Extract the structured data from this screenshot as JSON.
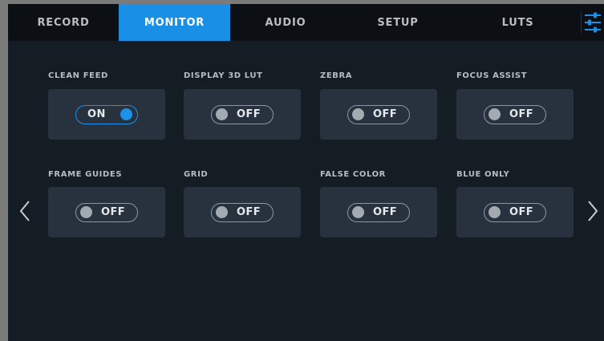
{
  "tabs": [
    {
      "label": "RECORD",
      "active": false
    },
    {
      "label": "MONITOR",
      "active": true
    },
    {
      "label": "AUDIO",
      "active": false
    },
    {
      "label": "SETUP",
      "active": false
    },
    {
      "label": "LUTS",
      "active": false
    }
  ],
  "settings": [
    {
      "label": "CLEAN FEED",
      "state": "ON"
    },
    {
      "label": "DISPLAY 3D LUT",
      "state": "OFF"
    },
    {
      "label": "ZEBRA",
      "state": "OFF"
    },
    {
      "label": "FOCUS ASSIST",
      "state": "OFF"
    },
    {
      "label": "FRAME GUIDES",
      "state": "OFF"
    },
    {
      "label": "GRID",
      "state": "OFF"
    },
    {
      "label": "FALSE COLOR",
      "state": "OFF"
    },
    {
      "label": "BLUE ONLY",
      "state": "OFF"
    }
  ],
  "icons": {
    "settings": "sliders-icon",
    "prev": "chevron-left-icon",
    "next": "chevron-right-icon"
  },
  "colors": {
    "accent": "#1a8fe6",
    "background": "#141c24",
    "card": "#27323e",
    "tabbar": "#0c0f13"
  }
}
